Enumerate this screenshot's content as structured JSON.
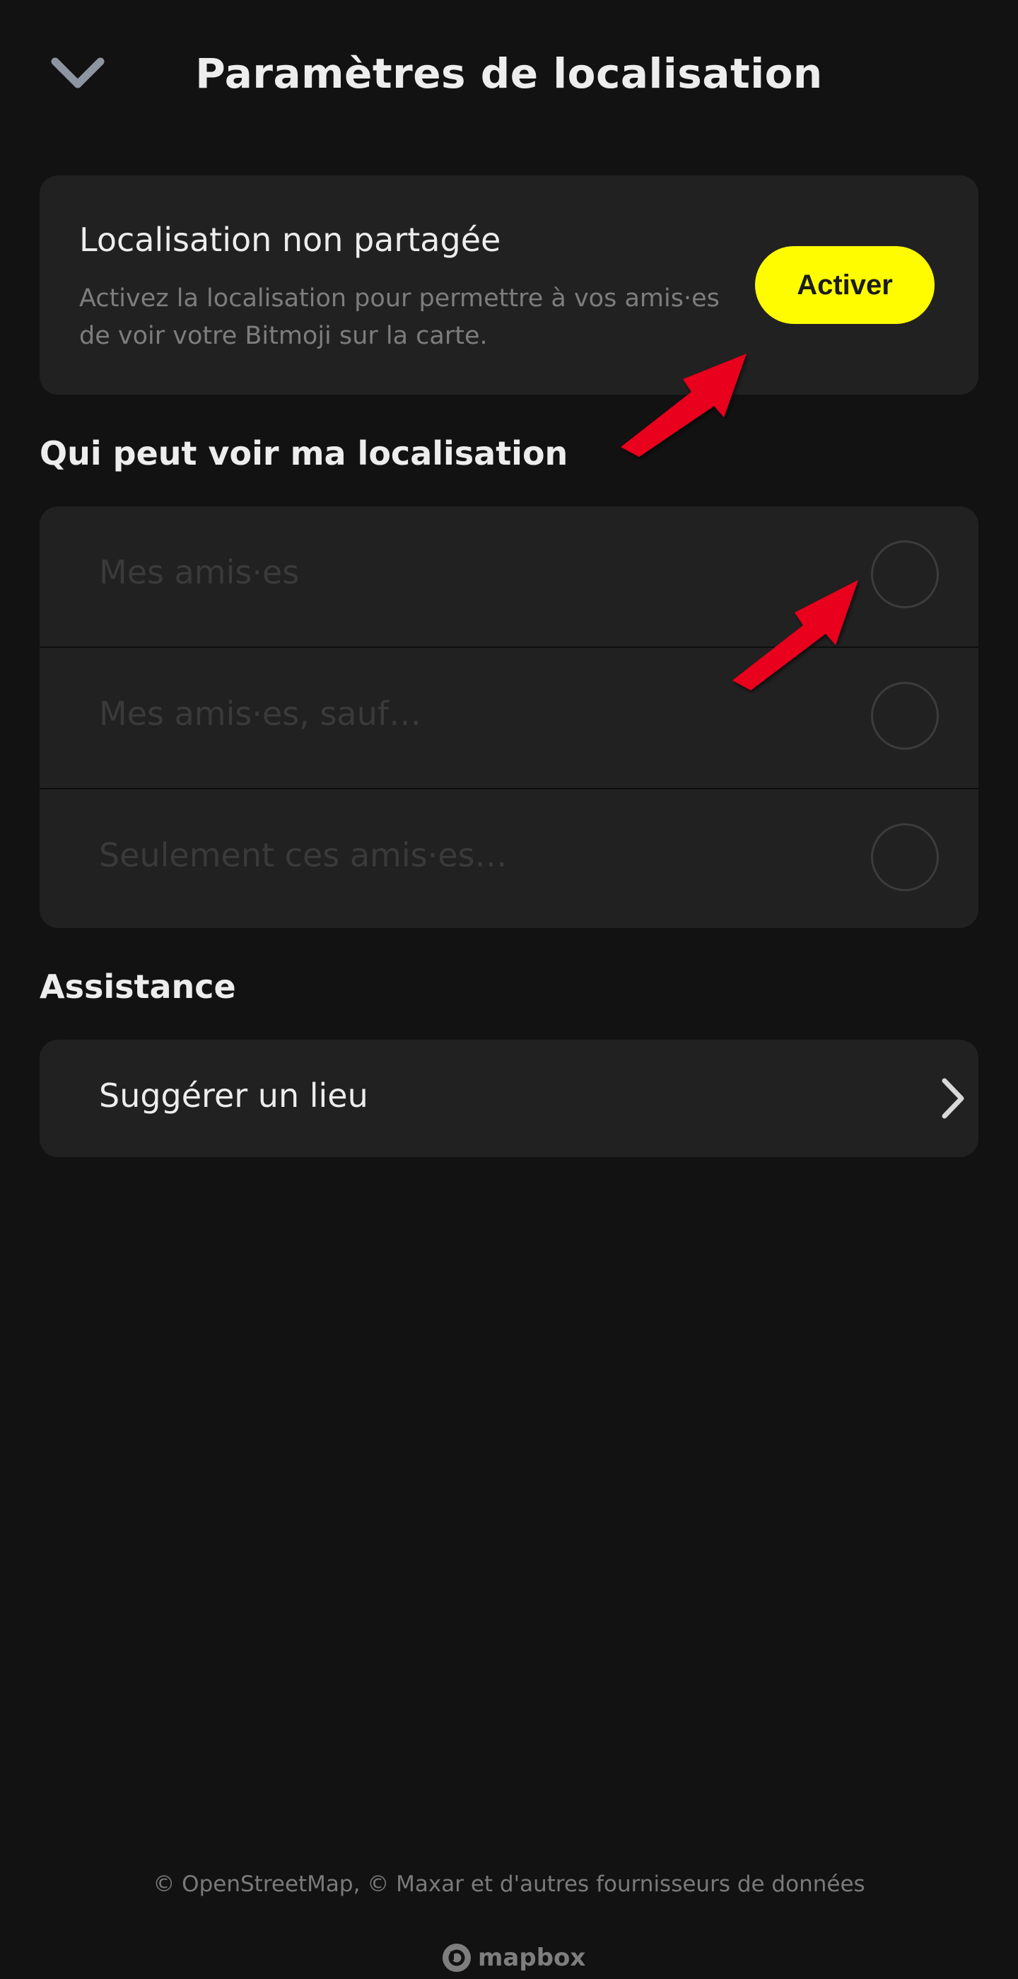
{
  "header": {
    "title": "Paramètres de localisation",
    "back_icon": "chevron-down-icon"
  },
  "status_card": {
    "title": "Localisation non partagée",
    "description": "Activez la localisation pour permettre à vos amis·es de voir votre Bitmoji sur la carte.",
    "activate_label": "Activer"
  },
  "visibility": {
    "heading": "Qui peut voir ma localisation",
    "options": [
      {
        "label": "Mes amis·es",
        "selected": false
      },
      {
        "label": "Mes amis·es, sauf…",
        "selected": false
      },
      {
        "label": "Seulement ces amis·es…",
        "selected": false
      }
    ]
  },
  "support": {
    "heading": "Assistance",
    "suggest_label": "Suggérer un lieu"
  },
  "footer": {
    "attribution": "© OpenStreetMap, © Maxar et d'autres fournisseurs de données",
    "mapbox_label": "mapbox"
  },
  "colors": {
    "background": "#121212",
    "card": "#212121",
    "accent": "#fffc00",
    "annotation": "#e8001c"
  }
}
